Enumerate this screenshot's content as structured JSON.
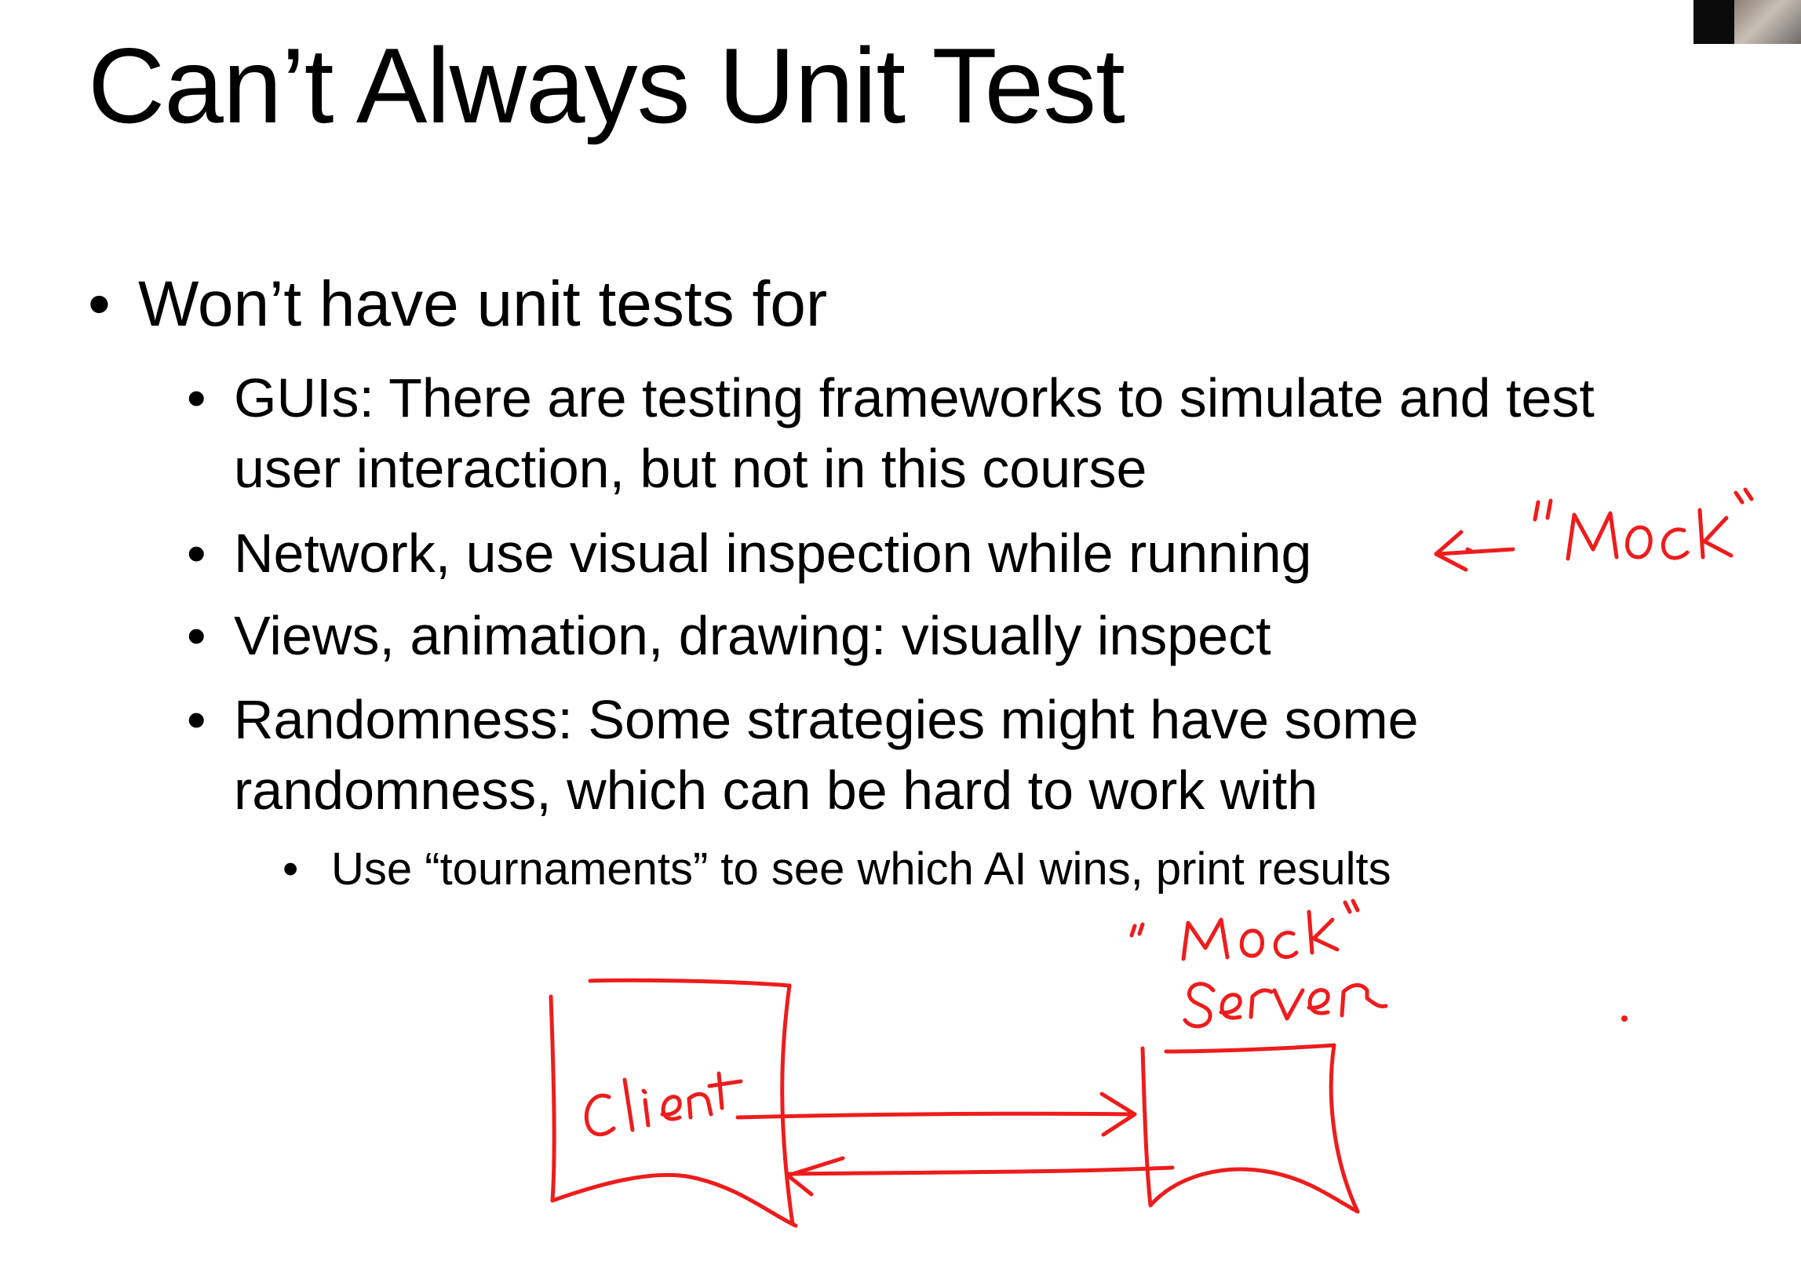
{
  "slide": {
    "title": "Can’t Always Unit Test",
    "bullet_symbol": "•",
    "bullets": [
      {
        "text": "Won’t have unit tests for",
        "children": [
          {
            "lines": [
              "GUIs:  There are testing frameworks to simulate and test",
              "user interaction, but not in this course"
            ]
          },
          {
            "lines": [
              "Network, use visual inspection while running"
            ]
          },
          {
            "lines": [
              "Views, animation, drawing: visually inspect"
            ]
          },
          {
            "lines": [
              "Randomness: Some strategies might have some",
              "randomness, which can be hard to work with"
            ],
            "children": [
              {
                "text": "Use “tournaments” to see which AI wins, print results"
              }
            ]
          }
        ]
      }
    ]
  },
  "annotations": {
    "ink_color": "#ee1c1c",
    "mock_note": "\"Mock\"",
    "mock_server_label": "\"Mock\" Server",
    "client_label": "Client"
  }
}
